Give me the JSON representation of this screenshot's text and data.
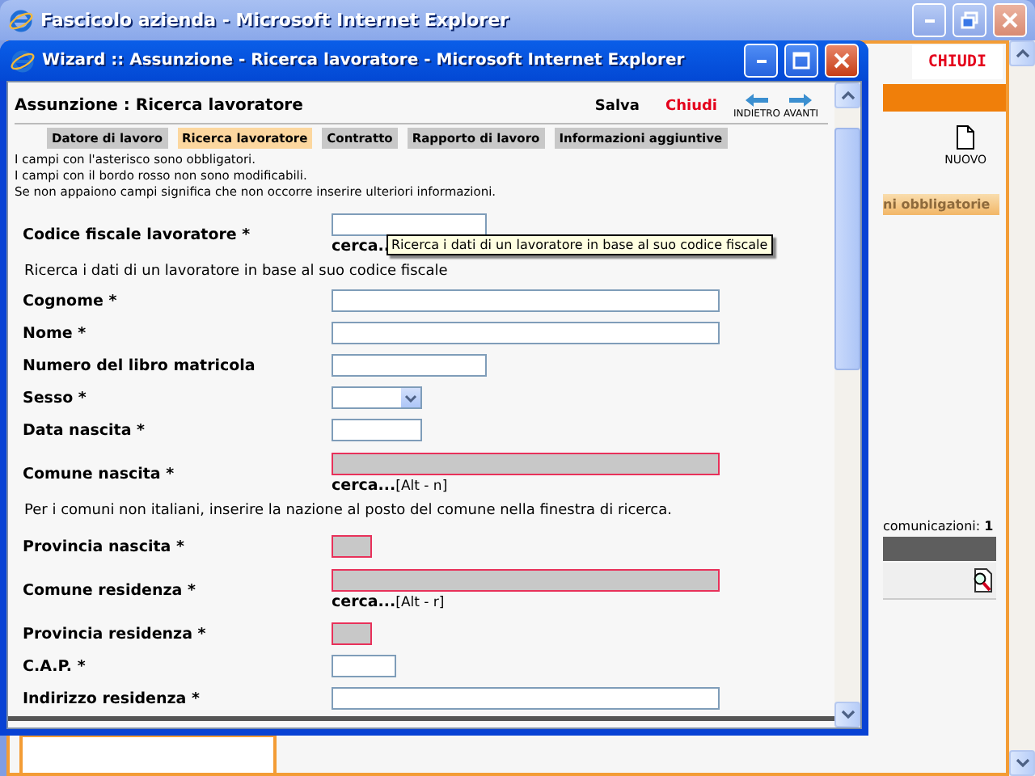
{
  "main_window": {
    "title": "Fascicolo azienda - Microsoft Internet Explorer",
    "close_link": "CHIUDI",
    "new_button": "NUOVO",
    "section_tab": "ni obbligatorie",
    "count_label": "comunicazioni:",
    "count_value": "1"
  },
  "wizard": {
    "title": "Wizard :: Assunzione - Ricerca lavoratore - Microsoft Internet Explorer",
    "heading": "Assunzione : Ricerca lavoratore",
    "actions": [
      {
        "label": "Salva",
        "kind": "save"
      },
      {
        "label": "Chiudi",
        "kind": "close"
      }
    ],
    "nav": [
      {
        "label": "INDIETRO",
        "kind": "back"
      },
      {
        "label": "AVANTI",
        "kind": "forward"
      }
    ],
    "steps": [
      {
        "label": "Datore di lavoro",
        "selected": false
      },
      {
        "label": "Ricerca lavoratore",
        "selected": true
      },
      {
        "label": "Contratto",
        "selected": false
      },
      {
        "label": "Rapporto di lavoro",
        "selected": false
      },
      {
        "label": "Informazioni aggiuntive",
        "selected": false
      }
    ],
    "instructions": [
      "I campi con l'asterisco sono obbligatori.",
      "I campi con il bordo rosso non sono modificabili.",
      "Se non appaiono campi significa che non occorre inserire ulteriori informazioni."
    ],
    "fields": [
      {
        "kind": "medium",
        "label": "Codice fiscale lavoratore *",
        "readonly": false,
        "search": "cerca..",
        "tooltip": "Ricerca i dati di un lavoratore in base al suo codice fiscale"
      },
      {
        "kind": "note",
        "text": "Ricerca i dati di un lavoratore in base al suo codice fiscale"
      },
      {
        "kind": "long",
        "label": "Cognome *",
        "readonly": false
      },
      {
        "kind": "long",
        "label": "Nome *",
        "readonly": false
      },
      {
        "kind": "medium",
        "label": "Numero del libro matricola",
        "readonly": false
      },
      {
        "kind": "select",
        "label": "Sesso *"
      },
      {
        "kind": "short",
        "label": "Data nascita *",
        "readonly": false
      },
      {
        "kind": "long",
        "label": "Comune nascita *",
        "readonly": true,
        "search": "cerca...",
        "shortcut": "[Alt - n]"
      },
      {
        "kind": "note",
        "text": "Per i comuni non italiani, inserire la nazione al posto del comune nella finestra di ricerca."
      },
      {
        "kind": "tiny",
        "label": "Provincia nascita *",
        "readonly": true
      },
      {
        "kind": "long",
        "label": "Comune residenza *",
        "readonly": true,
        "search": "cerca...",
        "shortcut": "[Alt - r]"
      },
      {
        "kind": "tiny",
        "label": "Provincia residenza *",
        "readonly": true
      },
      {
        "kind": "small",
        "label": "C.A.P. *",
        "readonly": false
      },
      {
        "kind": "long",
        "label": "Indirizzo residenza *",
        "readonly": false
      }
    ]
  }
}
